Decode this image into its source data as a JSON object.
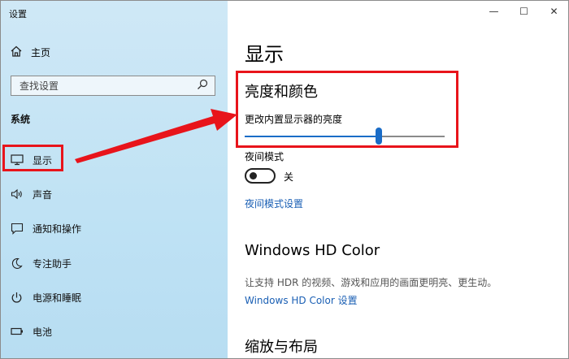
{
  "window": {
    "title": "设置",
    "controls": {
      "minimize": "—",
      "maximize": "☐",
      "close": "✕"
    }
  },
  "sidebar": {
    "home_label": "主页",
    "search_placeholder": "查找设置",
    "section_label": "系统",
    "items": [
      {
        "label": "显示",
        "icon": "monitor-icon"
      },
      {
        "label": "声音",
        "icon": "speaker-icon"
      },
      {
        "label": "通知和操作",
        "icon": "notification-icon"
      },
      {
        "label": "专注助手",
        "icon": "moon-icon"
      },
      {
        "label": "电源和睡眠",
        "icon": "power-icon"
      },
      {
        "label": "电池",
        "icon": "battery-icon"
      }
    ]
  },
  "main": {
    "page_title": "显示",
    "brightness_section": "亮度和颜色",
    "brightness_label": "更改内置显示器的亮度",
    "brightness_value": 0.67,
    "night_mode_label": "夜间模式",
    "night_mode_state": "关",
    "night_mode_settings_link": "夜间模式设置",
    "hd_color_section": "Windows HD Color",
    "hd_color_desc": "让支持 HDR 的视频、游戏和应用的画面更明亮、更生动。",
    "hd_color_link": "Windows HD Color 设置",
    "layout_section": "缩放与布局"
  },
  "colors": {
    "accent": "#1a6cc7",
    "highlight": "#e8141b",
    "link": "#1a5fb4"
  }
}
